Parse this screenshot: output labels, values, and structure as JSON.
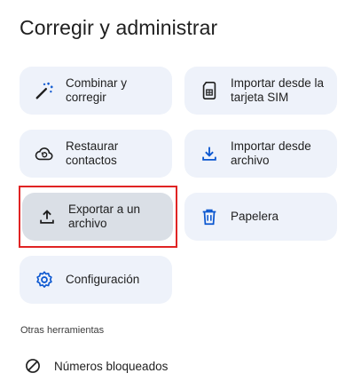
{
  "page": {
    "title": "Corregir y administrar"
  },
  "cards": [
    {
      "id": "merge",
      "label": "Combinar y corregir",
      "icon": "magic-wand-icon"
    },
    {
      "id": "import-sim",
      "label": "Importar desde la tarjeta SIM",
      "icon": "sim-card-icon"
    },
    {
      "id": "restore",
      "label": "Restaurar contactos",
      "icon": "cloud-restore-icon"
    },
    {
      "id": "import-file",
      "label": "Importar desde archivo",
      "icon": "download-icon"
    },
    {
      "id": "export",
      "label": "Exportar a un archivo",
      "icon": "upload-icon",
      "selected": true
    },
    {
      "id": "trash",
      "label": "Papelera",
      "icon": "trash-icon"
    },
    {
      "id": "settings",
      "label": "Configuración",
      "icon": "gear-icon"
    }
  ],
  "other_tools": {
    "heading": "Otras herramientas",
    "items": [
      {
        "label": "Números bloqueados",
        "icon": "blocked-icon"
      }
    ]
  },
  "colors": {
    "card_bg": "#eef2fa",
    "selected_bg": "#dadfe6",
    "icon": "#0b57d0",
    "highlight": "#e02424"
  }
}
